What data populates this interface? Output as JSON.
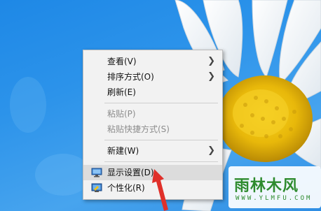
{
  "context_menu": {
    "items": [
      {
        "label": "查看(V)",
        "submenu": true
      },
      {
        "label": "排序方式(O)",
        "submenu": true
      },
      {
        "label": "刷新(E)"
      },
      {
        "label": "粘贴(P)",
        "disabled": true
      },
      {
        "label": "粘贴快捷方式(S)",
        "disabled": true
      },
      {
        "label": "新建(W)",
        "submenu": true
      },
      {
        "label": "显示设置(D)",
        "icon": "display-icon",
        "highlighted": true
      },
      {
        "label": "个性化(R)",
        "icon": "personalize-icon"
      }
    ]
  },
  "watermark": {
    "name": "雨林木风",
    "url": "WWW.YLMFU.COM"
  },
  "colors": {
    "desktop_blue": "#2c93ea",
    "menu_bg": "#f2f2f2",
    "highlight": "#dcdcdc",
    "arrow_red": "#e0302a",
    "logo_green": "#2e8b2e"
  }
}
